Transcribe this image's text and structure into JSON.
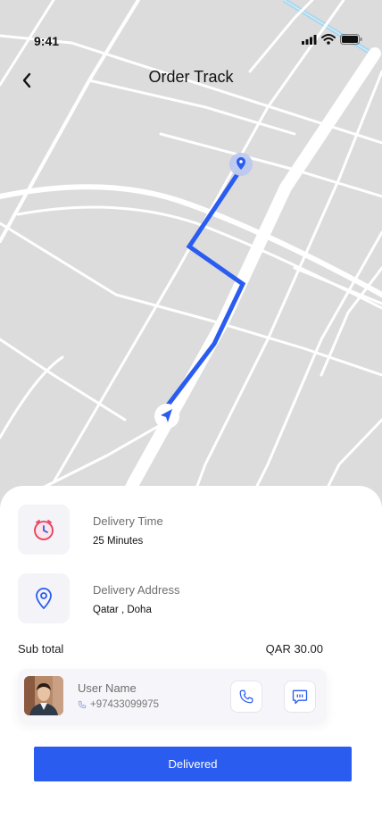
{
  "status_bar": {
    "time": "9:41"
  },
  "header": {
    "title": "Order Track"
  },
  "map": {
    "route_color": "#2a5cf0",
    "road_color": "#ffffff",
    "land_color": "#dcdcdc",
    "water_color": "#a8d8f0"
  },
  "delivery_time": {
    "label": "Delivery Time",
    "value": "25 Minutes",
    "icon": "clock-icon"
  },
  "delivery_address": {
    "label": "Delivery Address",
    "value": "Qatar , Doha",
    "icon": "location-pin-icon"
  },
  "subtotal": {
    "label": "Sub total",
    "value": "QAR 30.00"
  },
  "user": {
    "name": "User Name",
    "phone": "+97433099975"
  },
  "actions": {
    "call_icon": "phone-icon",
    "message_icon": "chat-icon"
  },
  "primary_button": {
    "label": "Delivered",
    "color": "#2a5cf0"
  }
}
